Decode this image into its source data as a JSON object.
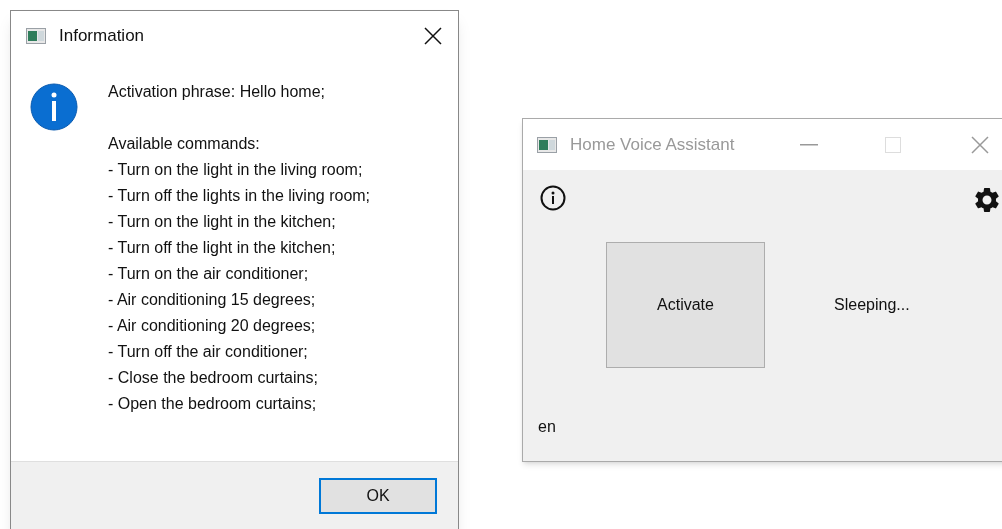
{
  "dialog": {
    "title": "Information",
    "active": true,
    "activation_phrase": "Activation phrase: Hello home;",
    "commands_heading": "Available commands:",
    "commands": [
      "- Turn on the light in the living room;",
      "- Turn off the lights in the living room;",
      "- Turn on the light in the kitchen;",
      "- Turn off the light in the kitchen;",
      "- Turn on the air conditioner;",
      "- Air conditioning 15 degrees;",
      "- Air conditioning 20 degrees;",
      "- Turn off the air conditioner;",
      "- Close the bedroom curtains;",
      "- Open the bedroom curtains;"
    ],
    "ok_button": {
      "label": "OK",
      "focused": true
    }
  },
  "main_window": {
    "title": "Home Voice Assistant",
    "active": false,
    "maximize_disabled": true,
    "activate_button": "Activate",
    "status": "Sleeping...",
    "language": "en"
  }
}
